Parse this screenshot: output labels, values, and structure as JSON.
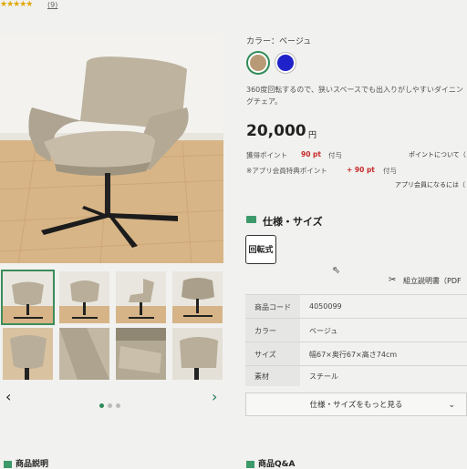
{
  "rating": {
    "stars": "★★★★★",
    "count": "(9)"
  },
  "gallery": {
    "prev_icon": "‹",
    "next_icon": "›"
  },
  "product": {
    "color_label": "カラー：ベージュ",
    "swatches": [
      "#b89b76",
      "#1f22c8"
    ],
    "description": "360度回転するので、狭いスペースでも出入りがしやすいダイニングチェア。",
    "price": "20,000",
    "price_unit": "円",
    "points_label": "獲得ポイント",
    "points_value": "90 pt",
    "points_suffix": "付与",
    "points_link": "ポイントについて（",
    "app_points_label": "※アプリ会員特典ポイント",
    "app_points_value": "+ 90 pt",
    "app_points_suffix": "付与",
    "app_link": "アプリ会員になるには（"
  },
  "spec": {
    "title": "仕様・サイズ",
    "tag": "回転式",
    "manual": "組立説明書（PDF",
    "rows": [
      {
        "key": "商品コード",
        "value": "4050099"
      },
      {
        "key": "カラー",
        "value": "ベージュ"
      },
      {
        "key": "サイズ",
        "value": "幅67×奥行67×高さ74cm"
      },
      {
        "key": "素材",
        "value": "スチール"
      }
    ],
    "more_button": "仕様・サイズをもっと見る",
    "more_icon": "⌄"
  },
  "bottom": {
    "left_title": "商品説明",
    "right_title": "商品Q&A"
  }
}
